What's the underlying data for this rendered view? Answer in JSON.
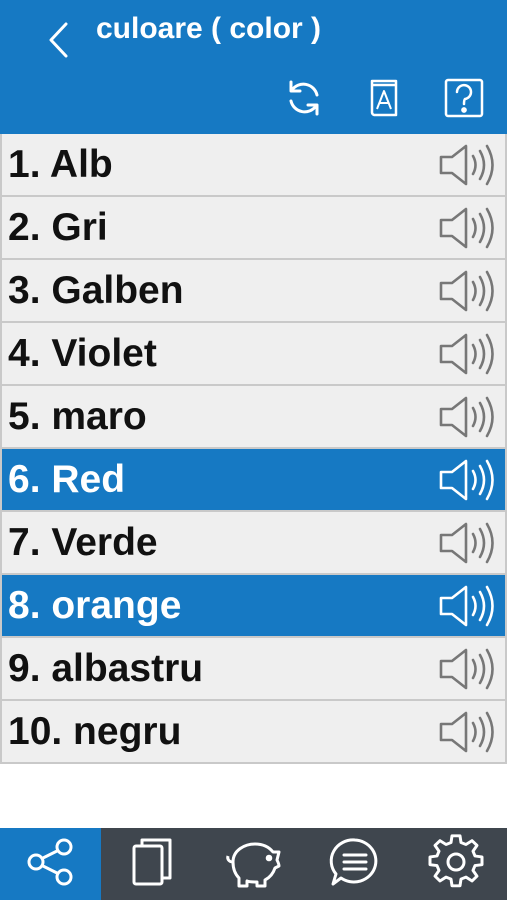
{
  "header": {
    "title": "culoare ( color )",
    "back_icon": "chevron-left-icon",
    "tools": [
      {
        "name": "refresh",
        "icon": "refresh-icon"
      },
      {
        "name": "dictionary",
        "icon": "book-a-icon",
        "glyph": "A"
      },
      {
        "name": "help",
        "icon": "help-icon",
        "glyph": "?"
      }
    ]
  },
  "words": [
    {
      "label": "1. Alb",
      "selected": false
    },
    {
      "label": "2. Gri",
      "selected": false
    },
    {
      "label": "3. Galben",
      "selected": false
    },
    {
      "label": "4. Violet",
      "selected": false
    },
    {
      "label": "5. maro",
      "selected": false
    },
    {
      "label": "6. Red",
      "selected": true
    },
    {
      "label": "7. Verde",
      "selected": false
    },
    {
      "label": "8. orange",
      "selected": true
    },
    {
      "label": "9. albastru",
      "selected": false
    },
    {
      "label": "10. negru",
      "selected": false
    }
  ],
  "row_icon": "speaker-icon",
  "bottom_nav": [
    {
      "name": "share",
      "icon": "share-icon",
      "active": true
    },
    {
      "name": "cards",
      "icon": "cards-icon",
      "active": false
    },
    {
      "name": "savings",
      "icon": "piggy-bank-icon",
      "active": false
    },
    {
      "name": "chat",
      "icon": "chat-icon",
      "active": false
    },
    {
      "name": "settings",
      "icon": "gear-icon",
      "active": false
    }
  ],
  "colors": {
    "accent": "#1679c3",
    "row_bg": "#efefef",
    "bottom_bar": "#3f464e"
  }
}
